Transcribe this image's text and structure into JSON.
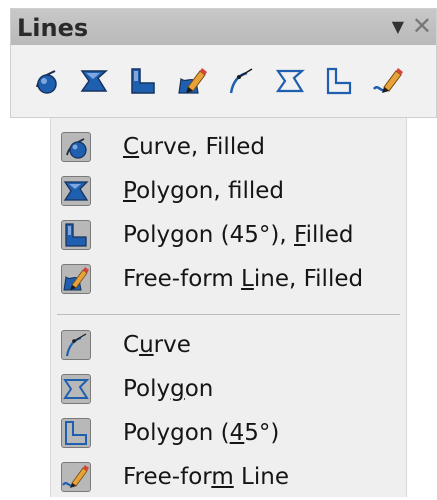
{
  "toolbar": {
    "title": "Lines",
    "menu_glyph": "▼",
    "close_glyph": "✕",
    "icons": [
      "curve-filled-icon",
      "polygon-filled-icon",
      "polygon-45-filled-icon",
      "freeform-line-filled-icon",
      "curve-icon",
      "polygon-icon",
      "polygon-45-icon",
      "freeform-line-icon"
    ]
  },
  "menu": {
    "items": [
      {
        "pre": "",
        "key": "C",
        "post": "urve, Filled",
        "icon": "curve-filled-icon"
      },
      {
        "pre": "",
        "key": "P",
        "post": "olygon, filled",
        "icon": "polygon-filled-icon"
      },
      {
        "pre": "Polygon (45°), ",
        "key": "F",
        "post": "illed",
        "icon": "polygon-45-filled-icon"
      },
      {
        "pre": "Free-form ",
        "key": "L",
        "post": "ine, Filled",
        "icon": "freeform-line-filled-icon"
      },
      {
        "pre": "C",
        "key": "u",
        "post": "rve",
        "icon": "curve-icon"
      },
      {
        "pre": "Poly",
        "key": "g",
        "post": "on",
        "icon": "polygon-icon"
      },
      {
        "pre": "Polygon (",
        "key": "4",
        "post": "5°)",
        "icon": "polygon-45-icon"
      },
      {
        "pre": "Free-for",
        "key": "m",
        "post": " Line",
        "icon": "freeform-line-icon"
      }
    ]
  },
  "colors": {
    "icon_blue": "#1f5fb0",
    "icon_light": "#7fa7dd",
    "pencil_orange": "#e7a23a",
    "pencil_red": "#d8443c"
  }
}
